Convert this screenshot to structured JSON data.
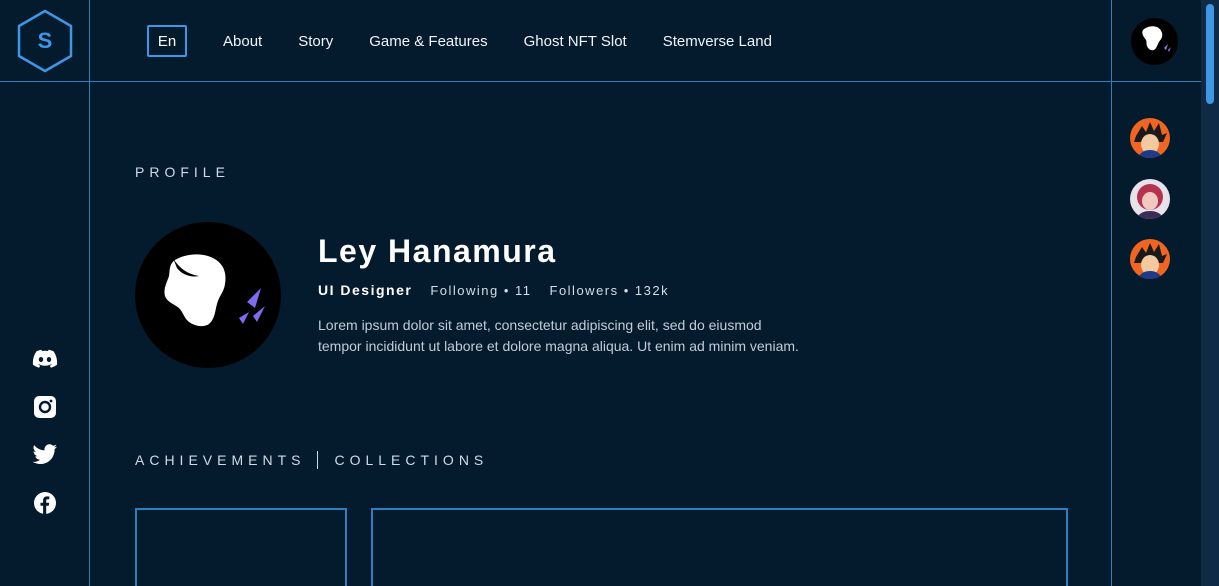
{
  "logo": {
    "letter": "S"
  },
  "nav": {
    "lang": "En",
    "links": [
      "About",
      "Story",
      "Game & Features",
      "Ghost NFT Slot",
      "Stemverse Land"
    ]
  },
  "socials": [
    "discord-icon",
    "instagram-icon",
    "twitter-icon",
    "facebook-icon"
  ],
  "profile": {
    "section_label": "PROFILE",
    "name": "Ley Hanamura",
    "role": "UI Designer",
    "following": "Following • 11",
    "followers": "Followers • 132k",
    "bio_line1": "Lorem ipsum dolor sit amet, consectetur adipiscing elit, sed do eiusmod",
    "bio_line2": "tempor incididunt ut labore et dolore magna aliqua. Ut enim ad minim veniam."
  },
  "tabs": {
    "achievements": "ACHIEVEMENTS",
    "collections": "COLLECTIONS"
  },
  "colors": {
    "accent": "#3d97e6",
    "background": "#041a2d",
    "line": "#2d7fc0"
  }
}
